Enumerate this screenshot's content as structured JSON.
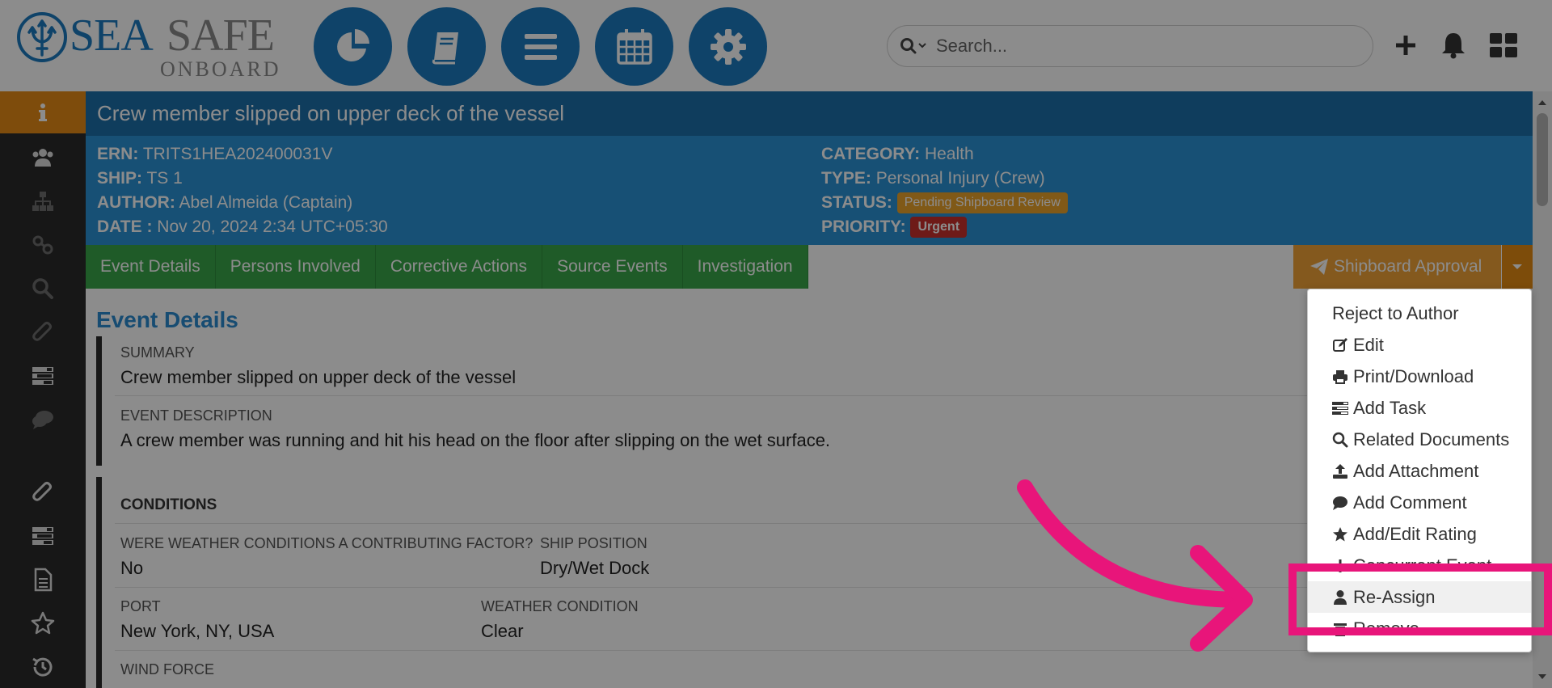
{
  "header": {
    "logo": {
      "sea": "SEA",
      "safe": "SAFE",
      "onboard": "ONBOARD"
    },
    "nav_icons": [
      "dashboard-pie-icon",
      "book-icon",
      "menu-lines-icon",
      "calendar-icon",
      "gear-icon"
    ],
    "search": {
      "placeholder": "Search..."
    },
    "right_icons": [
      "plus-icon",
      "bell-icon",
      "grid-icon"
    ]
  },
  "sidebar": {
    "items": [
      "info-icon",
      "users-icon",
      "hierarchy-icon",
      "link-icon",
      "search-icon",
      "paperclip-icon",
      "tasks-icon",
      "comment-icon",
      "paperclip-icon",
      "tasks-icon",
      "document-icon",
      "star-icon",
      "history-icon"
    ],
    "active_index": 0
  },
  "event": {
    "title": "Crew member slipped on upper deck of the vessel",
    "left": [
      {
        "label": "ERN:",
        "value": "TRITS1HEA202400031V"
      },
      {
        "label": "SHIP:",
        "value": "TS 1"
      },
      {
        "label": "AUTHOR:",
        "value": "Abel Almeida (Captain)"
      },
      {
        "label": "DATE :",
        "value": "Nov 20, 2024 2:34 UTC+05:30"
      }
    ],
    "right": [
      {
        "label": "CATEGORY:",
        "value": "Health"
      },
      {
        "label": "TYPE:",
        "value": "Personal Injury (Crew)"
      },
      {
        "label": "STATUS:",
        "value": "Pending Shipboard Review"
      },
      {
        "label": "PRIORITY:",
        "value": "Urgent"
      }
    ]
  },
  "tabs": [
    "Event Details",
    "Persons Involved",
    "Corrective Actions",
    "Source Events",
    "Investigation"
  ],
  "approval": {
    "label": "Shipboard Approval"
  },
  "details": {
    "heading": "Event Details",
    "summary_label": "SUMMARY",
    "summary_value": "Crew member slipped on upper deck of the vessel",
    "description_label": "EVENT DESCRIPTION",
    "description_value": "A crew member was running and hit his head on the floor after slipping on the wet surface.",
    "conditions_title": "CONDITIONS",
    "weather_factor_label": "WERE WEATHER CONDITIONS A CONTRIBUTING FACTOR?",
    "weather_factor_value": "No",
    "ship_position_label": "SHIP POSITION",
    "ship_position_value": "Dry/Wet Dock",
    "port_label": "PORT",
    "port_value": "New York, NY, USA",
    "weather_condition_label": "WEATHER CONDITION",
    "weather_condition_value": "Clear",
    "wind_force_label": "WIND FORCE"
  },
  "dropdown": {
    "items": [
      {
        "label": "Reject to Author",
        "icon": ""
      },
      {
        "label": "Edit",
        "icon": "edit-icon"
      },
      {
        "label": "Print/Download",
        "icon": "print-icon"
      },
      {
        "label": "Add Task",
        "icon": "tasks-icon"
      },
      {
        "label": "Related Documents",
        "icon": "search-icon"
      },
      {
        "label": "Add Attachment",
        "icon": "upload-icon"
      },
      {
        "label": "Add Comment",
        "icon": "comment-icon"
      },
      {
        "label": "Add/Edit Rating",
        "icon": "star-icon"
      },
      {
        "label": "Concurrent Event",
        "icon": "link-icon"
      },
      {
        "label": "Re-Assign",
        "icon": "user-icon"
      },
      {
        "label": "Remove",
        "icon": "trash-icon"
      }
    ],
    "highlighted": "Re-Assign"
  },
  "colors": {
    "brand_blue": "#1d7bbf",
    "title_bar": "#1d6fa9",
    "meta_bar": "#2a92d6",
    "tab_green": "#3aa64a",
    "approval_orange": "#f0a237",
    "annotation_pink": "#e8157a"
  }
}
